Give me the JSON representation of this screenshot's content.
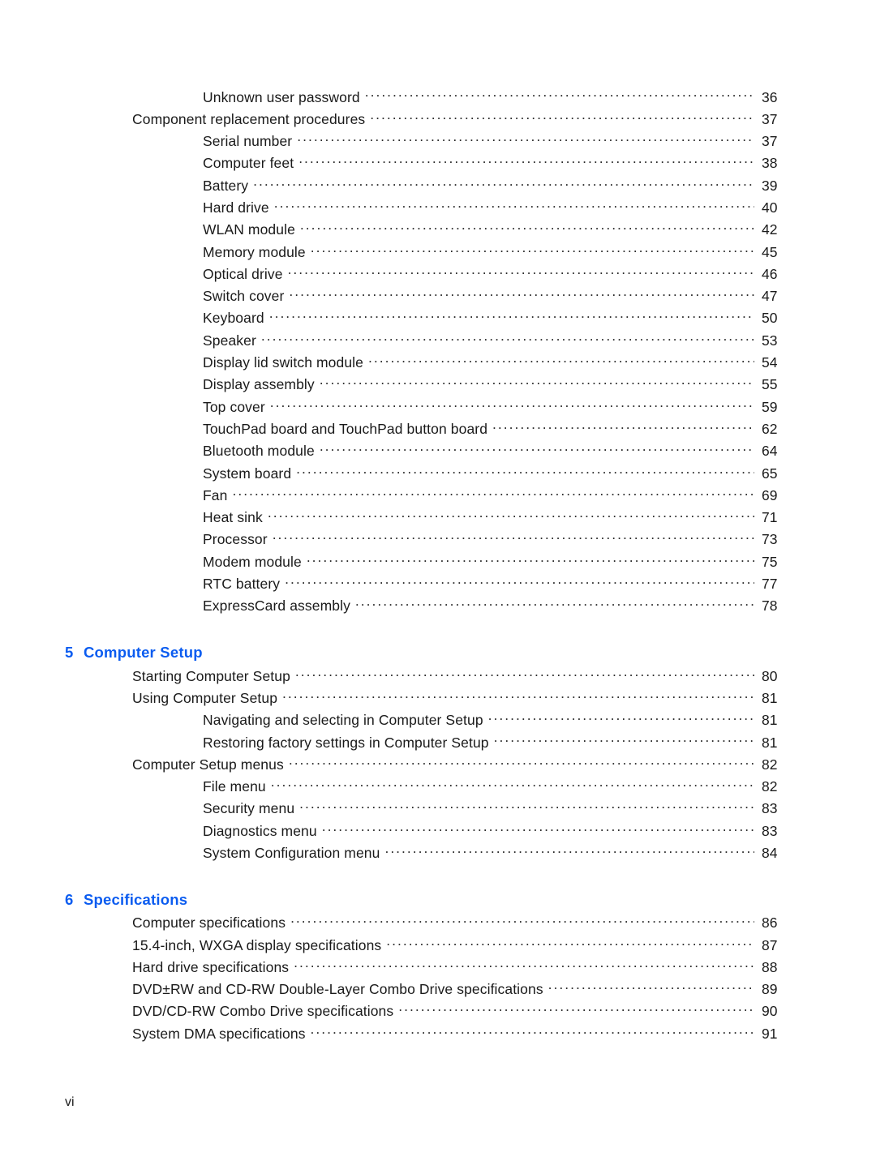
{
  "document": {
    "kind": "table-of-contents",
    "folio": "vi",
    "heading_color": "#0b5cf0",
    "text_color": "#1a1a1a"
  },
  "blocks": [
    {
      "type": "entries",
      "entries": [
        {
          "level": 2,
          "title": "Unknown user password",
          "page": "36"
        },
        {
          "level": 1,
          "title": "Component replacement procedures",
          "page": "37"
        },
        {
          "level": 2,
          "title": "Serial number",
          "page": "37"
        },
        {
          "level": 2,
          "title": "Computer feet",
          "page": "38"
        },
        {
          "level": 2,
          "title": "Battery",
          "page": "39"
        },
        {
          "level": 2,
          "title": "Hard drive",
          "page": "40"
        },
        {
          "level": 2,
          "title": "WLAN module",
          "page": "42"
        },
        {
          "level": 2,
          "title": "Memory module",
          "page": "45"
        },
        {
          "level": 2,
          "title": "Optical drive",
          "page": "46"
        },
        {
          "level": 2,
          "title": "Switch cover",
          "page": "47"
        },
        {
          "level": 2,
          "title": "Keyboard",
          "page": "50"
        },
        {
          "level": 2,
          "title": "Speaker",
          "page": "53"
        },
        {
          "level": 2,
          "title": "Display lid switch module",
          "page": "54"
        },
        {
          "level": 2,
          "title": "Display assembly",
          "page": "55"
        },
        {
          "level": 2,
          "title": "Top cover",
          "page": "59"
        },
        {
          "level": 2,
          "title": "TouchPad board and TouchPad button board",
          "page": "62"
        },
        {
          "level": 2,
          "title": "Bluetooth module",
          "page": "64"
        },
        {
          "level": 2,
          "title": "System board",
          "page": "65"
        },
        {
          "level": 2,
          "title": "Fan",
          "page": "69"
        },
        {
          "level": 2,
          "title": "Heat sink",
          "page": "71"
        },
        {
          "level": 2,
          "title": "Processor",
          "page": "73"
        },
        {
          "level": 2,
          "title": "Modem module",
          "page": "75"
        },
        {
          "level": 2,
          "title": "RTC battery",
          "page": "77"
        },
        {
          "level": 2,
          "title": "ExpressCard assembly",
          "page": "78"
        }
      ]
    },
    {
      "type": "chapter",
      "number": "5",
      "title": "Computer Setup",
      "entries": [
        {
          "level": 1,
          "title": "Starting Computer Setup",
          "page": "80"
        },
        {
          "level": 1,
          "title": "Using Computer Setup",
          "page": "81"
        },
        {
          "level": 2,
          "title": "Navigating and selecting in Computer Setup",
          "page": "81"
        },
        {
          "level": 2,
          "title": "Restoring factory settings in Computer Setup",
          "page": "81"
        },
        {
          "level": 1,
          "title": "Computer Setup menus",
          "page": "82"
        },
        {
          "level": 2,
          "title": "File menu",
          "page": "82"
        },
        {
          "level": 2,
          "title": "Security menu",
          "page": "83"
        },
        {
          "level": 2,
          "title": "Diagnostics menu",
          "page": "83"
        },
        {
          "level": 2,
          "title": "System Configuration menu",
          "page": "84"
        }
      ]
    },
    {
      "type": "chapter",
      "number": "6",
      "title": "Specifications",
      "entries": [
        {
          "level": 1,
          "title": "Computer specifications",
          "page": "86"
        },
        {
          "level": 1,
          "title": "15.4-inch, WXGA display specifications",
          "page": "87"
        },
        {
          "level": 1,
          "title": "Hard drive specifications",
          "page": "88"
        },
        {
          "level": 1,
          "title": "DVD±RW and CD-RW Double-Layer Combo Drive specifications",
          "page": "89"
        },
        {
          "level": 1,
          "title": "DVD/CD-RW Combo Drive specifications",
          "page": "90"
        },
        {
          "level": 1,
          "title": "System DMA specifications",
          "page": "91"
        }
      ]
    }
  ]
}
